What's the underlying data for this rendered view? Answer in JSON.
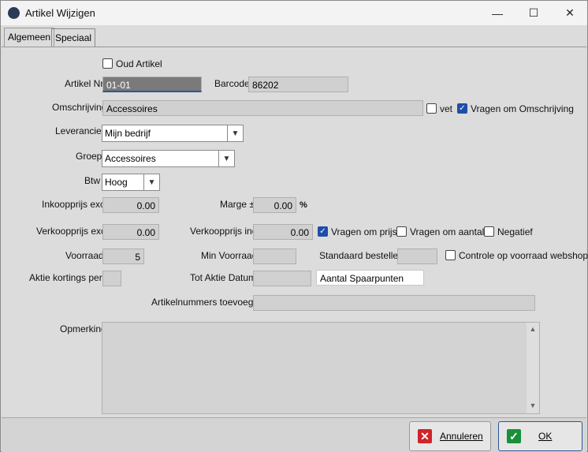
{
  "window": {
    "title": "Artikel Wijzigen",
    "minimize": "—",
    "maximize": "☐",
    "close": "✕"
  },
  "tabs": [
    {
      "label": "Algemeen"
    },
    {
      "label": "Speciaal"
    }
  ],
  "form": {
    "oud_artikel_label": "Oud Artikel",
    "artikel_nr_label": "Artikel Nr",
    "artikel_nr_value": "01-01",
    "barcode_label": "Barcode",
    "barcode_value": "86202",
    "omschrijving_label": "Omschrijving",
    "omschrijving_value": "Accessoires",
    "vet_label": "vet",
    "vragen_omschrijving_label": "Vragen om Omschrijving",
    "leverancier_label": "Leverancier",
    "leverancier_value": "Mijn bedrijf",
    "groep_label": "Groep",
    "groep_value": "Accessoires",
    "btw_label": "Btw",
    "btw_value": "Hoog",
    "inkoopprijs_label": "Inkoopprijs excl",
    "inkoopprijs_value": "0.00",
    "marge_label": "Marge ±",
    "marge_value": "0.00",
    "marge_unit": "%",
    "verkoopprijs_excl_label": "Verkoopprijs excl",
    "verkoopprijs_excl_value": "0.00",
    "verkoopprijs_incl_label": "Verkoopprijs incl",
    "verkoopprijs_incl_value": "0.00",
    "vragen_prijs_label": "Vragen om prijs",
    "vragen_aantal_label": "Vragen om aantal",
    "negatief_label": "Negatief",
    "voorraad_label": "Voorraad",
    "voorraad_value": "5",
    "min_voorraad_label": "Min Voorraad",
    "standaard_bestellen_label": "Standaard bestellen",
    "controle_voorraad_label": "Controle op voorraad webshop",
    "aktie_kortings_label": "Aktie kortings perc",
    "tot_aktie_datum_label": "Tot Aktie Datum",
    "aantal_spaarpunten_placeholder": "Aantal Spaarpunten",
    "artikelnummers_label": "Artikelnummers toevoegen",
    "opmerking_label": "Opmerking"
  },
  "buttons": {
    "annuleren": "Annuleren",
    "ok": "OK"
  },
  "colors": {
    "accent": "#1e4fa8",
    "cancel_icon": "#d0232a",
    "ok_icon": "#1a8f3a"
  }
}
